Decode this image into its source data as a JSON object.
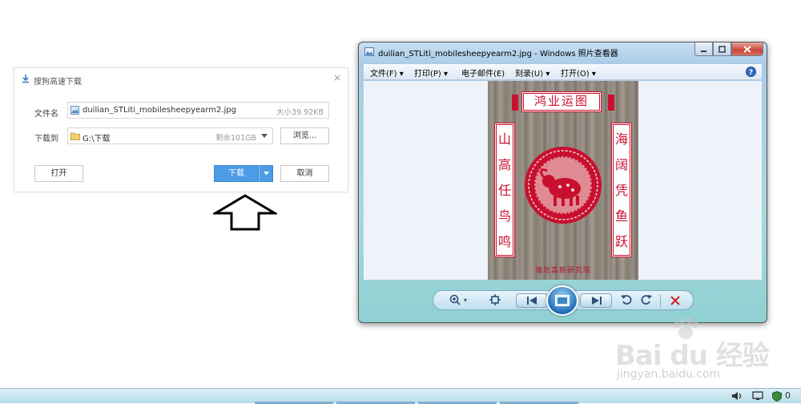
{
  "download_dialog": {
    "title": "搜狗高速下载",
    "close_glyph": "×",
    "filename_label": "文件名",
    "filename_value": "duilian_STLiti_mobilesheepyearm2.jpg",
    "filesize": "大小39.92KB",
    "save_to_label": "下载到",
    "save_path": "G:\\下载",
    "free_space": "剩余101GB",
    "browse_label": "浏览...",
    "open_label": "打开",
    "download_label": "下载",
    "cancel_label": "取消"
  },
  "viewer": {
    "title": "duilian_STLiti_mobilesheepyearm2.jpg - Windows 照片查看器",
    "menu": [
      {
        "label": "文件(F)"
      },
      {
        "label": "打印(P)"
      },
      {
        "label": "电子邮件(E)"
      },
      {
        "label": "刻录(U)"
      },
      {
        "label": "打开(O)"
      }
    ],
    "help_glyph": "?",
    "image": {
      "top_banner": "鸿业运图",
      "left_couplet": "山高任鸟鸣",
      "right_couplet": "海阔凭鱼跃",
      "footer": "潍坊高新研究院"
    }
  },
  "taskbar": {
    "tray_number": "0"
  },
  "watermark": {
    "brand": "Bai du 经验",
    "url": "jingyan.baidu.com"
  },
  "colors": {
    "download_blue": "#4b9be6",
    "couplet_red": "#c8102e",
    "taskbar": "#b7dbe9"
  }
}
